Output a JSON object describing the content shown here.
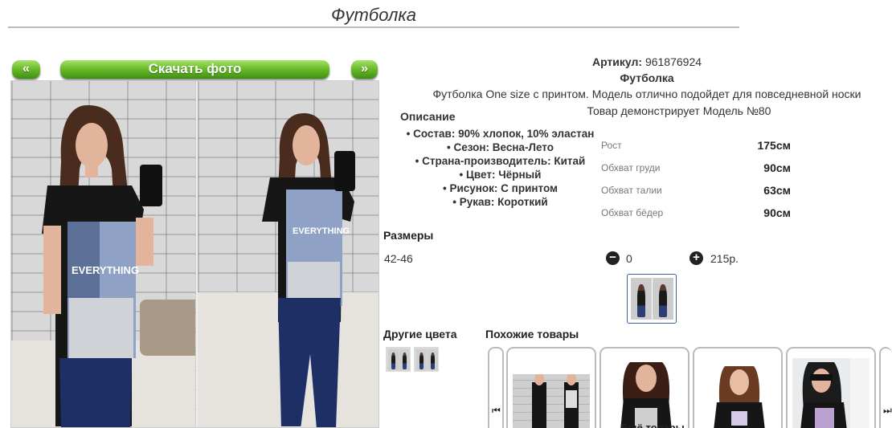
{
  "page": {
    "title": "Футболка"
  },
  "gallery": {
    "prev_label": "«",
    "download_label": "Скачать фото",
    "next_label": "»"
  },
  "product": {
    "article_label": "Артикул:",
    "article_value": "961876924",
    "name": "Футболка",
    "description": "Футболка One size с принтом. Модель отлично подойдет для повседневной носки",
    "model_note": "Товар демонстрирует Модель №80"
  },
  "description_block": {
    "title": "Описание",
    "items": [
      "Состав: 90% хлопок, 10% эластан",
      "Сезон: Весна-Лето",
      "Страна-производитель: Китай",
      "Цвет: Чёрный",
      "Рисунок: С принтом",
      "Рукав: Короткий"
    ]
  },
  "measurements": [
    {
      "label": "Рост",
      "value": "175см"
    },
    {
      "label": "Обхват груди",
      "value": "90см"
    },
    {
      "label": "Обхват талии",
      "value": "63см"
    },
    {
      "label": "Обхват бёдер",
      "value": "90см"
    }
  ],
  "sizes": {
    "title": "Размеры",
    "size": "42-46",
    "minus_label": "−",
    "quantity": "0",
    "plus_label": "+",
    "price": "215р."
  },
  "other_colors": {
    "title": "Другие цвета"
  },
  "similar": {
    "title": "Похожие товары",
    "prev_arrow": "⏮",
    "next_arrow": "⏭",
    "more_label": "Ещё товары"
  },
  "colors": {
    "button_green": "#6cbd2c",
    "thumb_border": "#3a5da8"
  }
}
